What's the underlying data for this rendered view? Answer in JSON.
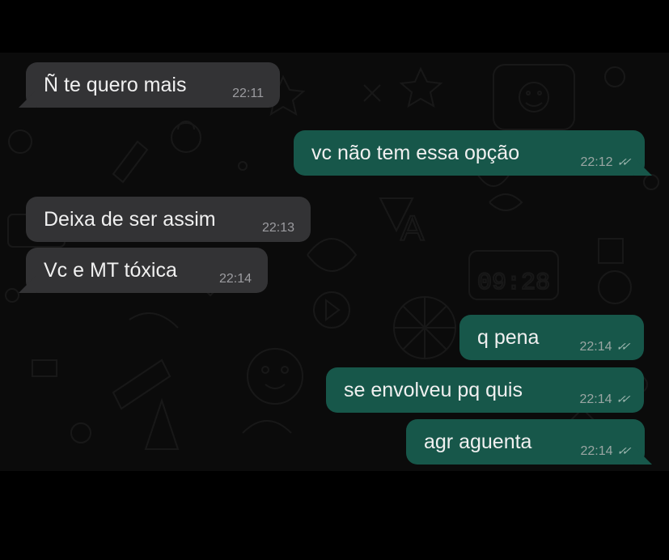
{
  "messages": [
    {
      "text": "Ñ te quero mais",
      "time": "22:11",
      "direction": "incoming"
    },
    {
      "text": "vc não tem essa opção",
      "time": "22:12",
      "direction": "outgoing",
      "status": "delivered"
    },
    {
      "text": "Deixa de ser assim",
      "time": "22:13",
      "direction": "incoming"
    },
    {
      "text": "Vc e MT tóxica",
      "time": "22:14",
      "direction": "incoming"
    },
    {
      "text": "q pena",
      "time": "22:14",
      "direction": "outgoing",
      "status": "delivered"
    },
    {
      "text": "se envolveu pq quis",
      "time": "22:14",
      "direction": "outgoing",
      "status": "delivered"
    },
    {
      "text": "agr aguenta",
      "time": "22:14",
      "direction": "outgoing",
      "status": "delivered"
    }
  ],
  "ticks_glyph": "✓✓",
  "colors": {
    "background": "#000000",
    "incoming_bubble": "#333335",
    "outgoing_bubble": "#17574a",
    "text": "#f0f0f0",
    "meta": "#9aa6a3"
  }
}
